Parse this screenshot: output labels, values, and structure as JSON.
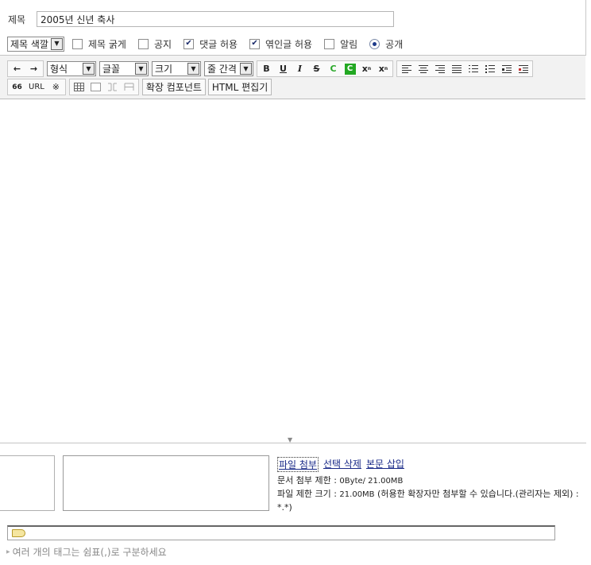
{
  "post": {
    "title_label": "제목",
    "title_value": "2005년 신년 축사"
  },
  "options": {
    "color_select": "제목 색깔",
    "bold_title": {
      "label": "제목 굵게",
      "checked": false
    },
    "notice": {
      "label": "공지",
      "checked": false
    },
    "allow_comments": {
      "label": "댓글 허용",
      "checked": true
    },
    "allow_trackback": {
      "label": "엮인글 허용",
      "checked": true
    },
    "notify": {
      "label": "알림",
      "checked": false
    },
    "public": {
      "label": "공개",
      "selected": true
    }
  },
  "toolbar": {
    "undo_icon": "←",
    "redo_icon": "→",
    "format_select": "형식",
    "font_select": "글꼴",
    "size_select": "크기",
    "line_height_select": "줄 간격",
    "bold": "B",
    "underline": "U",
    "italic": "I",
    "strike": "S",
    "font_color": "C",
    "bg_color": "C",
    "superscript": "x",
    "subscript": "x",
    "quote": "66",
    "url": "URL",
    "special_char": "※",
    "extension_label": "확장 컴포넌트",
    "html_edit_label": "HTML 편집기"
  },
  "attachments": {
    "attach_link": "파일 첨부",
    "delete_link": "선택 삭제",
    "insert_link": "본문 삽입",
    "doc_limit_label": "문서 첨부 제한 : ",
    "doc_limit_value": "0Byte/ 21.00MB",
    "file_limit_label": "파일 제한 크기 : ",
    "file_limit_value": "21.00MB",
    "file_limit_note": " (허용한 확장자만 첨부할 수 있습니다.(관리자는 제외) : *.*)"
  },
  "tags": {
    "input_value": "",
    "hint": "여러 개의 태그는 쉼표(,)로 구분하세요"
  },
  "colors": {
    "link": "#1a2a88",
    "toolbar_bg": "#f2f2f2",
    "green": "#22a822"
  }
}
